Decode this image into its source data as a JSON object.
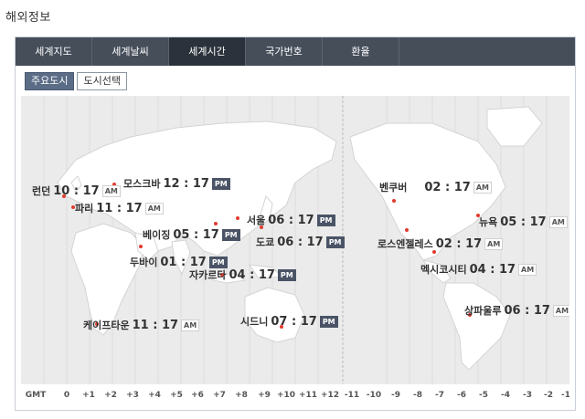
{
  "page": {
    "title": "해외정보"
  },
  "tabs": [
    {
      "label": "세계지도",
      "active": false
    },
    {
      "label": "세계날씨",
      "active": false
    },
    {
      "label": "세계시간",
      "active": true
    },
    {
      "label": "국가번호",
      "active": false
    },
    {
      "label": "환율",
      "active": false
    }
  ],
  "subtabs": [
    {
      "label": "주요도시",
      "active": true
    },
    {
      "label": "도시선택",
      "active": false
    }
  ],
  "cities": [
    {
      "name": "런던",
      "time": "10 : 17",
      "ampm": "AM"
    },
    {
      "name": "모스크바",
      "time": "12 : 17",
      "ampm": "PM"
    },
    {
      "name": "파리",
      "time": "11 : 17",
      "ampm": "AM"
    },
    {
      "name": "베이징",
      "time": "05 : 17",
      "ampm": "PM"
    },
    {
      "name": "서울",
      "time": "06 : 17",
      "ampm": "PM"
    },
    {
      "name": "도쿄",
      "time": "06 : 17",
      "ampm": "PM"
    },
    {
      "name": "두바이",
      "time": "01 : 17",
      "ampm": "PM"
    },
    {
      "name": "자카르타",
      "time": "04 : 17",
      "ampm": "PM"
    },
    {
      "name": "케이프타운",
      "time": "11 : 17",
      "ampm": "AM"
    },
    {
      "name": "시드니",
      "time": "07 : 17",
      "ampm": "PM"
    },
    {
      "name": "벤쿠버",
      "time": "02 : 17",
      "ampm": "AM"
    },
    {
      "name": "뉴욕",
      "time": "05 : 17",
      "ampm": "AM"
    },
    {
      "name": "로스엔젤레스",
      "time": "02 : 17",
      "ampm": "AM"
    },
    {
      "name": "멕시코시티",
      "time": "04 : 17",
      "ampm": "AM"
    },
    {
      "name": "상파울루",
      "time": "06 : 17",
      "ampm": "AM"
    }
  ],
  "gmt": {
    "label": "GMT",
    "offsets": [
      "0",
      "+1",
      "+2",
      "+3",
      "+4",
      "+5",
      "+6",
      "+7",
      "+8",
      "+9",
      "+10",
      "+11",
      "+12",
      "-11",
      "-10",
      "-9",
      "-8",
      "-7",
      "-6",
      "-5",
      "-4",
      "-3",
      "-2",
      "-1"
    ]
  },
  "colors": {
    "tab_bg": "#464e5a",
    "tab_active": "#2c323b",
    "pm_badge": "#4a5466",
    "city_dot": "#e23b2e"
  }
}
